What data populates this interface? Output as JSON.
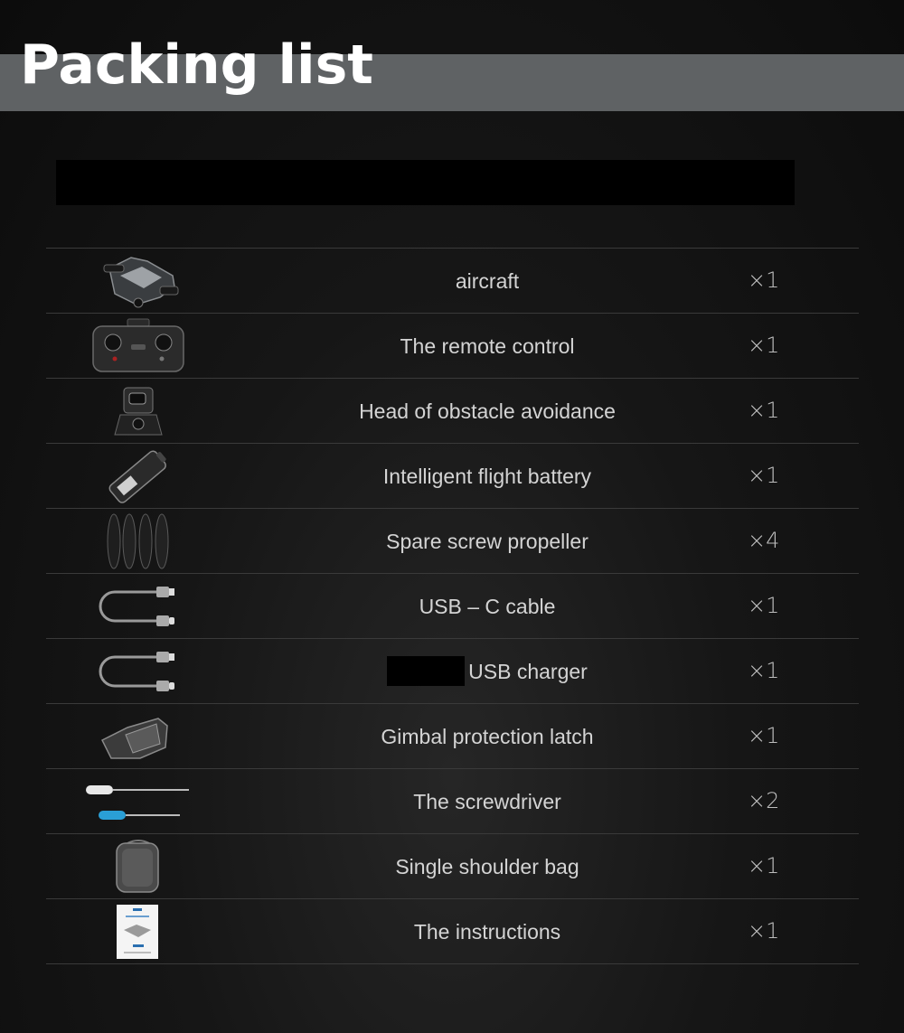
{
  "header": {
    "title": "Packing list"
  },
  "items": [
    {
      "name": "aircraft",
      "qty": "×1",
      "icon": "drone-icon"
    },
    {
      "name": "The remote control",
      "qty": "×1",
      "icon": "remote-control-icon"
    },
    {
      "name": "Head of obstacle avoidance",
      "qty": "×1",
      "icon": "obstacle-avoidance-head-icon"
    },
    {
      "name": "Intelligent flight battery",
      "qty": "×1",
      "icon": "battery-icon"
    },
    {
      "name": "Spare screw propeller",
      "qty": "×4",
      "icon": "propeller-icon"
    },
    {
      "name": "USB – C cable",
      "qty": "×1",
      "icon": "usb-c-cable-icon"
    },
    {
      "name": "USB charger",
      "qty": "×1",
      "icon": "usb-charger-icon"
    },
    {
      "name": "Gimbal protection latch",
      "qty": "×1",
      "icon": "gimbal-latch-icon"
    },
    {
      "name": "The screwdriver",
      "qty": "×2",
      "icon": "screwdriver-icon"
    },
    {
      "name": "Single shoulder bag",
      "qty": "×1",
      "icon": "shoulder-bag-icon"
    },
    {
      "name": "The instructions",
      "qty": "×1",
      "icon": "instructions-icon"
    }
  ]
}
